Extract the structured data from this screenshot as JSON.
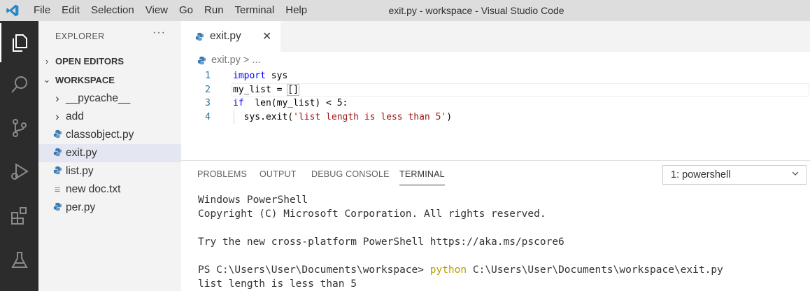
{
  "titlebar": {
    "menu": [
      "File",
      "Edit",
      "Selection",
      "View",
      "Go",
      "Run",
      "Terminal",
      "Help"
    ],
    "title": "exit.py - workspace - Visual Studio Code"
  },
  "activity_bar": {
    "icons": [
      "explorer-icon",
      "search-icon",
      "source-control-icon",
      "run-debug-icon",
      "extensions-icon",
      "testing-icon"
    ],
    "active": "explorer-icon"
  },
  "sidebar": {
    "header": "EXPLORER",
    "more": "···",
    "open_editors": "OPEN EDITORS",
    "workspace": "WORKSPACE",
    "items": [
      {
        "label": "__pycache__",
        "kind": "folder"
      },
      {
        "label": "add",
        "kind": "folder"
      },
      {
        "label": "classobject.py",
        "kind": "python"
      },
      {
        "label": "exit.py",
        "kind": "python",
        "selected": true
      },
      {
        "label": "list.py",
        "kind": "python"
      },
      {
        "label": "new doc.txt",
        "kind": "text"
      },
      {
        "label": "per.py",
        "kind": "python"
      }
    ]
  },
  "editor": {
    "tab_label": "exit.py",
    "breadcrumb_file": "exit.py",
    "breadcrumb_rest": "> ...",
    "lines": [
      {
        "num": "1",
        "tokens": [
          [
            "kw",
            "import"
          ],
          [
            "",
            "sys"
          ]
        ]
      },
      {
        "num": "2",
        "tokens": [
          [
            "",
            "my_list = "
          ],
          [
            "br",
            "[]"
          ]
        ]
      },
      {
        "num": "3",
        "tokens": [
          [
            "kw",
            "if"
          ],
          [
            "",
            " len(my_list) < 5:"
          ]
        ]
      },
      {
        "num": "4",
        "tokens": [
          [
            "",
            "  sys.exit("
          ],
          [
            "str",
            "'list length is less than 5'"
          ],
          [
            "",
            ")"
          ]
        ]
      }
    ]
  },
  "panel": {
    "tabs": [
      "PROBLEMS",
      "OUTPUT",
      "DEBUG CONSOLE",
      "TERMINAL"
    ],
    "active_tab": "TERMINAL",
    "terminal_select": "1: powershell",
    "terminal_lines": [
      "Windows PowerShell",
      "Copyright (C) Microsoft Corporation. All rights reserved.",
      "",
      "Try the new cross-platform PowerShell https://aka.ms/pscore6",
      ""
    ],
    "prompt": "PS C:\\Users\\User\\Documents\\workspace> ",
    "prompt_cmd": "python",
    "prompt_args": " C:\\Users\\User\\Documents\\workspace\\exit.py",
    "output": "list length is less than 5"
  }
}
